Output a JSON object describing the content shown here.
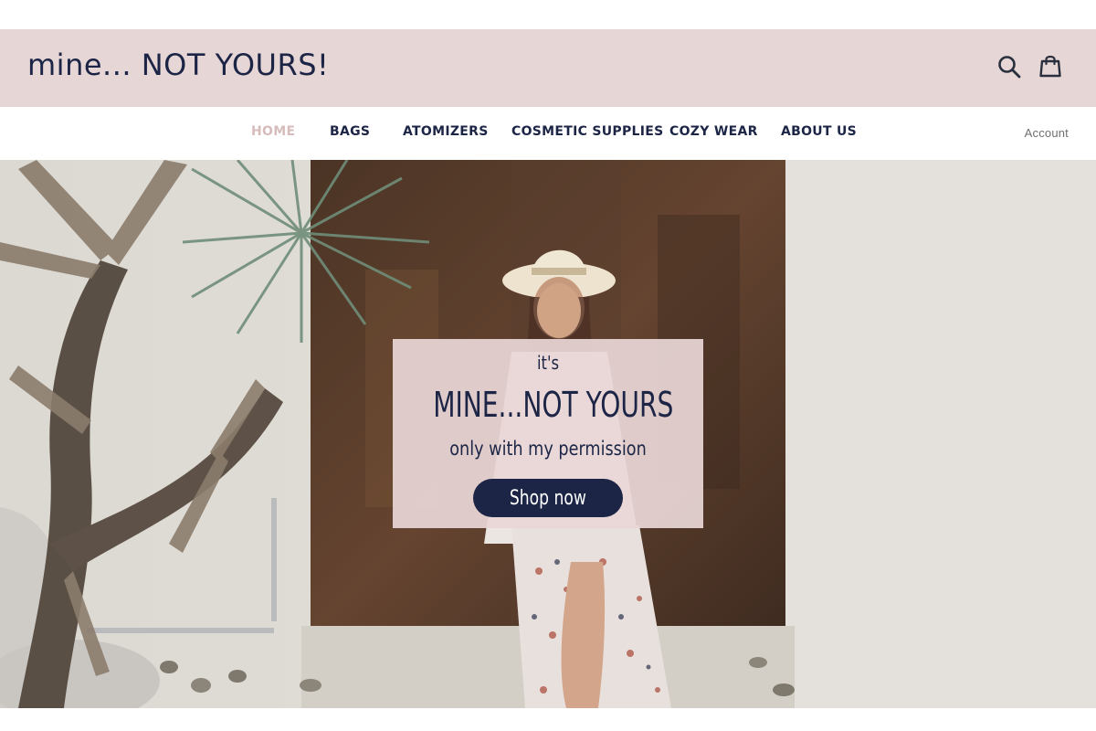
{
  "header": {
    "logo": "mine... NOT YOURS!",
    "icons": {
      "search": "search-icon",
      "cart": "shopping-bag-icon"
    },
    "background": "#e7d6d6"
  },
  "nav": {
    "items": [
      {
        "label": "HOME",
        "active": true
      },
      {
        "label": "BAGS"
      },
      {
        "label": "ATOMIZERS"
      },
      {
        "label": "COSMETIC SUPPLIES"
      },
      {
        "label": "COZY WEAR"
      },
      {
        "label": "ABOUT US"
      }
    ],
    "account": "Account",
    "active_color": "#d7bcbc"
  },
  "hero": {
    "pre": "it's",
    "title": "MINE...NOT YOURS",
    "subtitle": "only with my permission",
    "cta": "Shop now"
  },
  "colors": {
    "brand_navy": "#1c2546",
    "pink": "#e7d6d6"
  }
}
